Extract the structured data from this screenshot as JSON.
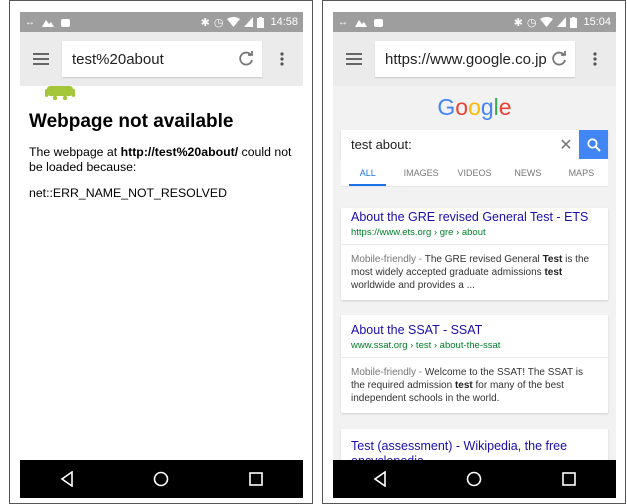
{
  "left_phone": {
    "status": {
      "time": "14:58"
    },
    "toolbar": {
      "url": "test%20about"
    },
    "error": {
      "title": "Webpage not available",
      "body_prefix": "The webpage at ",
      "body_url": "http://test%20about/",
      "body_suffix": " could not be loaded because:",
      "code": "net::ERR_NAME_NOT_RESOLVED"
    }
  },
  "right_phone": {
    "status": {
      "time": "15:04"
    },
    "toolbar": {
      "url": "https://www.google.co.jp"
    },
    "google": {
      "logo_letters": [
        {
          "ch": "G",
          "color": "#4285f4"
        },
        {
          "ch": "o",
          "color": "#ea4335"
        },
        {
          "ch": "o",
          "color": "#fbbc05"
        },
        {
          "ch": "g",
          "color": "#4285f4"
        },
        {
          "ch": "l",
          "color": "#34a853"
        },
        {
          "ch": "e",
          "color": "#ea4335"
        }
      ],
      "search_query": "test about:",
      "tabs": [
        "ALL",
        "IMAGES",
        "VIDEOS",
        "NEWS",
        "MAPS"
      ],
      "results": [
        {
          "title": "About the GRE revised General Test - ETS",
          "url": "https://www.ets.org › gre › about",
          "mobile_friendly": "Mobile-friendly - ",
          "snippet_parts": [
            "The GRE revised General ",
            "Test",
            " is the most widely accepted graduate admissions ",
            "test",
            " worldwide and provides a ..."
          ]
        },
        {
          "title": "About the SSAT - SSAT",
          "url": "www.ssat.org › test › about-the-ssat",
          "mobile_friendly": "Mobile-friendly - ",
          "snippet_parts": [
            "Welcome to the SSAT! The SSAT is the required admission ",
            "test",
            " for many of the best independent schools in the world."
          ]
        },
        {
          "title": "Test (assessment) - Wikipedia, the free encyclopedia"
        }
      ]
    }
  }
}
